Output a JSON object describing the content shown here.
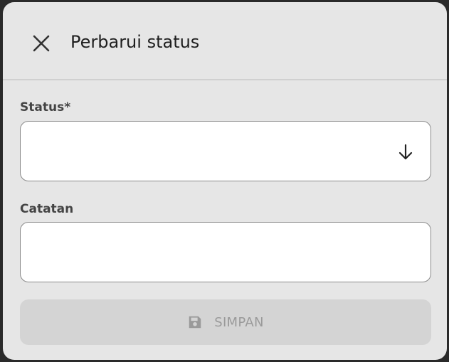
{
  "dialog": {
    "title": "Perbarui status",
    "close_icon": "close-icon"
  },
  "status_field": {
    "label": "Status*",
    "value": "",
    "icon": "arrow-down-icon"
  },
  "notes_field": {
    "label": "Catatan",
    "value": ""
  },
  "save_button": {
    "label": "SIMPAN",
    "icon": "save-icon",
    "disabled": true
  }
}
